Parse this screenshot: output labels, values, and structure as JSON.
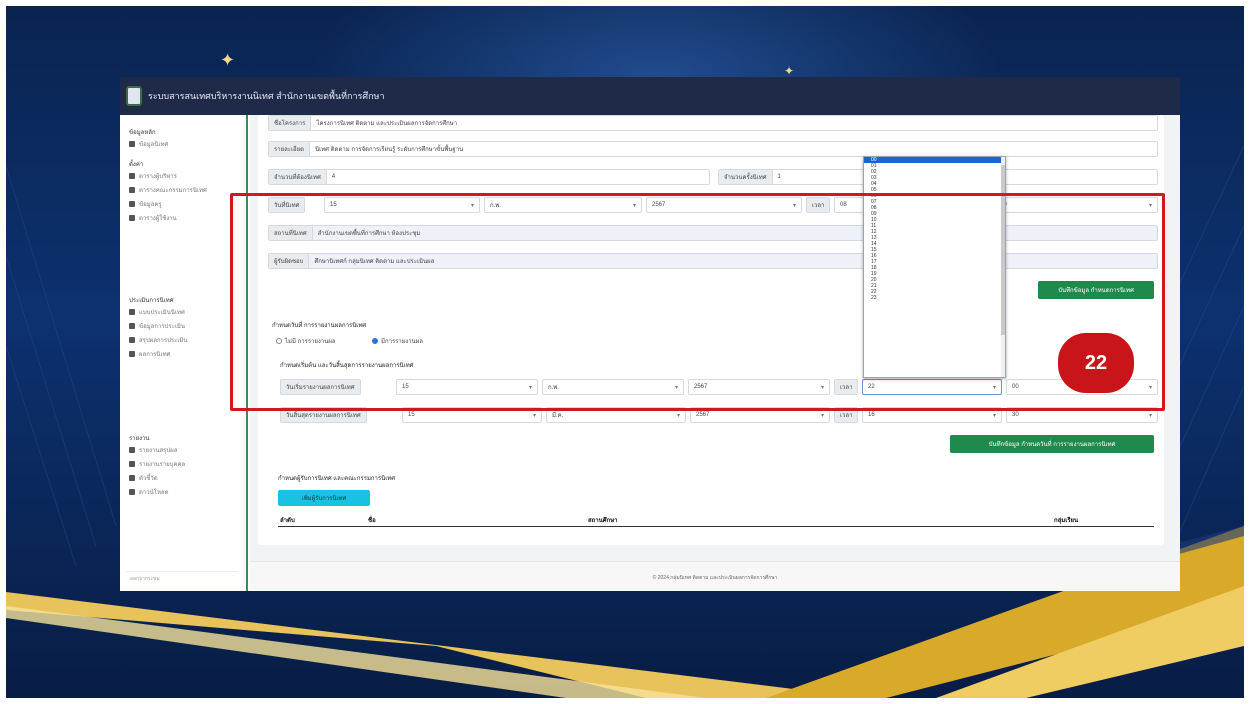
{
  "window": {
    "title": "ระบบสารสนเทศบริหารงานนิเทศ สำนักงานเขตพื้นที่การศึกษา"
  },
  "sidebar": {
    "groups": [
      {
        "heading": "ข้อมูลหลัก",
        "items": [
          "ข้อมูลนิเทศ"
        ]
      },
      {
        "heading": "ตั้งค่า",
        "items": [
          "ตารางผู้บริหาร",
          "ตารางคณะกรรมการนิเทศ",
          "ข้อมูลครู",
          "ตารางผู้ใช้งาน"
        ]
      },
      {
        "heading": "ประเมินการนิเทศ",
        "items": [
          "แบบประเมินนิเทศ",
          "ข้อมูลการประเมิน",
          "สรุปผลการประเมิน",
          "ผลการนิเทศ"
        ]
      },
      {
        "heading": "รายงาน",
        "items": [
          "รายงานสรุปผล",
          "รายงานรายบุคคล",
          "ตัวชี้วัด",
          "ดาวน์โหลด"
        ]
      }
    ],
    "footer": "ออกจากระบบ"
  },
  "form": {
    "row1": {
      "label": "ชื่อโครงการ",
      "value": "โครงการนิเทศ ติดตาม และประเมินผลการจัดการศึกษา"
    },
    "row2": {
      "label": "รายละเอียด",
      "value": "นิเทศ ติดตาม การจัดการเรียนรู้ ระดับการศึกษาขั้นพื้นฐาน"
    },
    "row3": {
      "label": "จำนวนที่ต้องนิเทศ",
      "value": "4",
      "label2": "จำนวนครั้งนิเทศ",
      "value2": "1"
    },
    "date_row": {
      "label": "วันที่นิเทศ",
      "day": "15",
      "month": "ก.พ.",
      "year": "2567",
      "time_label": "เวลา",
      "time_val": "08",
      "min_val": "00"
    },
    "row5": {
      "label": "สถานที่นิเทศ",
      "value": "สำนักงานเขตพื้นที่การศึกษา ห้องประชุม"
    },
    "row6": {
      "label": "ผู้รับผิดชอบ",
      "value": "ศึกษานิเทศก์ กลุ่มนิเทศ ติดตาม และประเมินผล"
    },
    "save1": "บันทึกข้อมูล กำหนดการนิเทศ",
    "section2_title": "กำหนดวันที่ การรายงานผลการนิเทศ",
    "radio1": "ไม่มี การรายงานผล",
    "radio2": "มีการรายงานผล",
    "section3_title": "กำหนดเริ่มต้น และวันสิ้นสุดการรายงานผลการนิเทศ",
    "start_row": {
      "label": "วันเริ่มรายงานผลการนิเทศ",
      "day": "15",
      "month": "ก.พ.",
      "year": "2567",
      "time_label": "เวลา",
      "time_val": "22",
      "min_val": "00"
    },
    "end_row": {
      "label": "วันสิ้นสุดรายงานผลการนิเทศ",
      "day": "15",
      "month": "มี.ค.",
      "year": "2567",
      "time_label": "เวลา",
      "time_val": "16",
      "min_val": "30"
    },
    "save2": "บันทึกข้อมูล กำหนดวันที่ การรายงานผลการนิเทศ",
    "section4_title": "กำหนดผู้รับการนิเทศ และคณะกรรมการนิเทศ",
    "add_button": "เพิ่มผู้รับการนิเทศ",
    "table_headers": [
      "ลำดับ",
      "ชื่อ",
      "สถานศึกษา",
      "กลุ่มเรียน"
    ]
  },
  "footer": "© 2024 กลุ่มนิเทศ ติดตาม และประเมินผลการจัดการศึกษา",
  "dropdown": {
    "options": [
      "00",
      "01",
      "02",
      "03",
      "04",
      "05",
      "06",
      "07",
      "08",
      "09",
      "10",
      "11",
      "12",
      "13",
      "14",
      "15",
      "16",
      "17",
      "18",
      "19",
      "20",
      "21",
      "22",
      "23"
    ],
    "selected": "00"
  },
  "callout": {
    "number": "22"
  },
  "colors": {
    "brand": "#1e2a47",
    "accent_green": "#1f8a4c",
    "highlight_red": "#d0181f",
    "cyan": "#19c2e3"
  }
}
